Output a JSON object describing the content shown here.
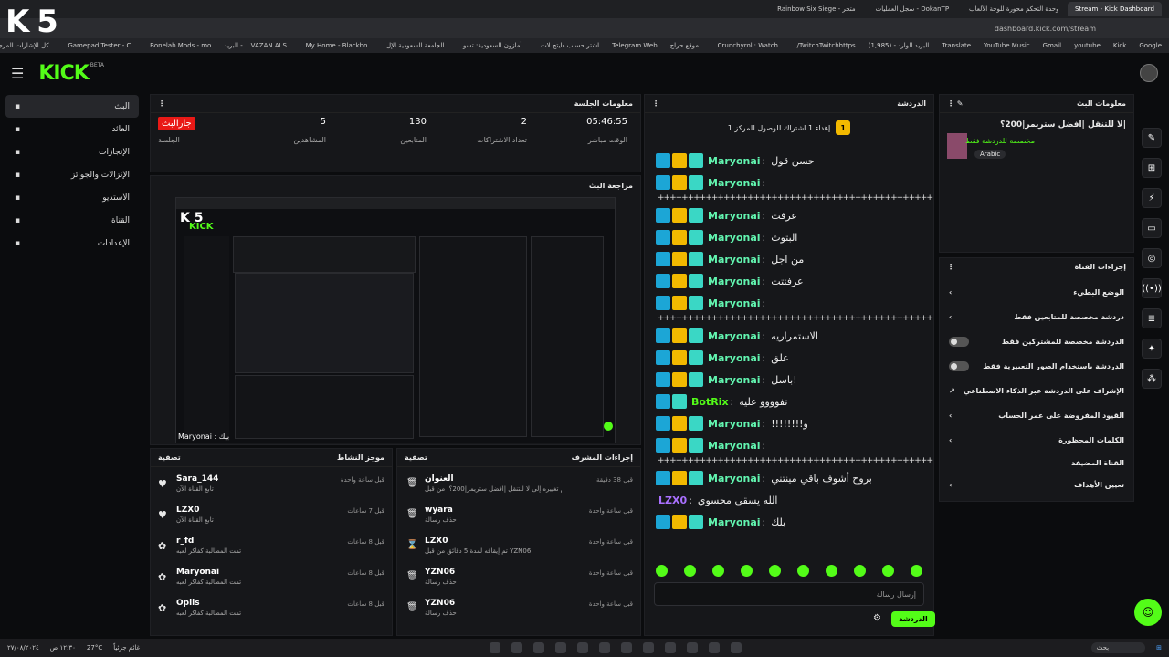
{
  "browser": {
    "tabs": [
      "Rainbow Six Siege - متجر",
      "سجل العمليات - DokanTP",
      "وحدة التحكم محورة للوحة الألعاب",
      "Stream - Kick Dashboard"
    ],
    "url": "dashboard.kick.com/stream",
    "bookmarks": [
      "Google",
      "Kick",
      "youtube",
      "Gmail",
      "YouTube Music",
      "Translate",
      "البريد الوارد - (1,985)",
      "TwitchTwitchhttps/...",
      "Crunchyroll: Watch...",
      "موقع حراج",
      "Telegram Web",
      "اشتر حساب دايتج لات...",
      "أمازون السعودية: تسو...",
      "الجامعة السعودية الإل...",
      "My Home - Blackbo...",
      "VAZAN ALS... - البريد",
      "Bonelab Mods - mo...",
      "Gamepad Tester - C...",
      "كل الإشارات المرجعية"
    ],
    "overlay_logo": "K 5"
  },
  "topbar": {
    "logo": "KICK",
    "logo_sub": "BETA"
  },
  "sidebar": [
    {
      "label": "البث",
      "icon": "live-icon",
      "active": true
    },
    {
      "label": "العائد",
      "icon": "wallet-icon"
    },
    {
      "label": "الإنجازات",
      "icon": "trophy-icon"
    },
    {
      "label": "الإنزالات والجوائز",
      "icon": "gift-icon"
    },
    {
      "label": "الاستديو",
      "icon": "studio-icon"
    },
    {
      "label": "القناة",
      "icon": "channel-icon"
    },
    {
      "label": "الإعدادات",
      "icon": "settings-icon"
    }
  ],
  "session": {
    "title": "معلومات الجلسة",
    "stats": [
      {
        "value": "05:46:55",
        "label": "الوقت مباشر"
      },
      {
        "value": "2",
        "label": "تعداد الاشتراكات"
      },
      {
        "value": "130",
        "label": "المتابعين"
      },
      {
        "value": "5",
        "label": "المشاهدين"
      },
      {
        "value": "جارالبث",
        "label": "الجلسة"
      }
    ]
  },
  "preview": {
    "title": "مراجعة البث",
    "caption": "Maryonai : بيك"
  },
  "activity": {
    "title": "موجز النشاط",
    "filter": "تصفية",
    "items": [
      {
        "name": "Sara_144",
        "text": "تابع القناة الآن",
        "time": "قبل ساعة واحدة"
      },
      {
        "name": "LZX0",
        "text": "تابع القناة الآن",
        "time": "قبل 7 ساعات"
      },
      {
        "name": "r_fd",
        "text": "تمت المطالبة كفاكر لعبه",
        "time": "قبل 8 ساعات"
      },
      {
        "name": "Maryonai",
        "text": "تمت المطالبة كفاكر لعبه",
        "time": "قبل 8 ساعات"
      },
      {
        "name": "Opiis",
        "text": "تمت المطالبة كفاكر لعبه",
        "time": "قبل 8 ساعات"
      }
    ]
  },
  "mod": {
    "title": "إجراءات المشرف",
    "filter": "تصفية",
    "items": [
      {
        "name": "العنوان",
        "text": "تم تغييره إلى لا للتنقل |افضل ستريمر|200؟| من قبل YZN06",
        "time": "قبل 38 دقيقة"
      },
      {
        "name": "wyara",
        "text": "حذف رسالة",
        "time": "قبل ساعة واحدة"
      },
      {
        "name": "LZX0",
        "text": "تم إيقافه لمدة 5 دقائق من قبل YZN06",
        "time": "قبل ساعة واحدة"
      },
      {
        "name": "YZN06",
        "text": "حذف رسالة",
        "time": "قبل ساعة واحدة"
      },
      {
        "name": "YZN06",
        "text": "حذف رسالة",
        "time": "قبل ساعة واحدة"
      }
    ]
  },
  "chat": {
    "title": "الدردشة",
    "goal": "إهداء 1 اشتراك للوصول للمركز 1",
    "goal_rank": "1",
    "messages": [
      {
        "user": "Maryonai",
        "text": "حسن قول",
        "type": "user"
      },
      {
        "user": "Maryonai",
        "text": "",
        "type": "user"
      },
      {
        "sep": true
      },
      {
        "user": "Maryonai",
        "text": "عرفت",
        "type": "user"
      },
      {
        "user": "Maryonai",
        "text": "البثوث",
        "type": "user"
      },
      {
        "user": "Maryonai",
        "text": "من اجل",
        "type": "user"
      },
      {
        "user": "Maryonai",
        "text": "عرفتتت",
        "type": "user"
      },
      {
        "user": "Maryonai",
        "text": "",
        "type": "user"
      },
      {
        "sep": true
      },
      {
        "user": "Maryonai",
        "text": "الاستمراريه",
        "type": "user"
      },
      {
        "user": "Maryonai",
        "text": "علق",
        "type": "user"
      },
      {
        "user": "Maryonai",
        "text": "باسل!",
        "type": "user"
      },
      {
        "user": "BotRix",
        "text": "تفوووو عليه",
        "type": "bot"
      },
      {
        "user": "Maryonai",
        "text": "!!!!!!!!و",
        "type": "user"
      },
      {
        "user": "Maryonai",
        "text": "",
        "type": "user"
      },
      {
        "sep": true
      },
      {
        "user": "Maryonai",
        "text": "بروح أشوف باقي مينتني",
        "type": "user"
      },
      {
        "user": "LZX0",
        "text": "الله يسقي محسوي",
        "type": "lzx"
      },
      {
        "user": "Maryonai",
        "text": "بلك",
        "type": "user"
      }
    ],
    "separator": "+++++++++++++++++++++++++++++++++++++++++++++++++++",
    "placeholder": "إرسال رسالة",
    "send": "الدردشة"
  },
  "stream_info": {
    "title": "معلومات البث",
    "stream_title": "|لا للتنقل |افضل ستريمر|200؟",
    "category": "مخصصة للدردشة فقط",
    "language": "Arabic"
  },
  "channel_actions": {
    "title": "إجراءات القناة",
    "items": [
      {
        "label": "الوضع البطيء",
        "control": "chevron"
      },
      {
        "label": "دردشة مخصصة للمتابعين فقط",
        "control": "chevron"
      },
      {
        "label": "الدردشة مخصصة للمشتركين فقط",
        "control": "toggle"
      },
      {
        "label": "الدردشة باستخدام الصور التعبيرية فقط",
        "control": "toggle"
      },
      {
        "label": "الإشراف على الدردشة عبر الذكاء الاصطناعي",
        "control": "link"
      },
      {
        "label": "القيود المفروضة على عمر الحساب",
        "control": "chevron"
      },
      {
        "label": "الكلمات المحظورة",
        "control": "chevron"
      },
      {
        "label": "القناة المضيفة",
        "control": "none"
      },
      {
        "label": "تعيين الأهداف",
        "control": "chevron"
      }
    ]
  },
  "taskbar": {
    "time": "١٢:٣٠ ص",
    "date": "٢٧/٠٨/٢٠٢٤",
    "weather": "27°C",
    "weather_text": "غائم جزئياً",
    "search": "بحث"
  },
  "colors": {
    "accent": "#53fc18",
    "live": "#e91916",
    "panel": "#16171a"
  }
}
